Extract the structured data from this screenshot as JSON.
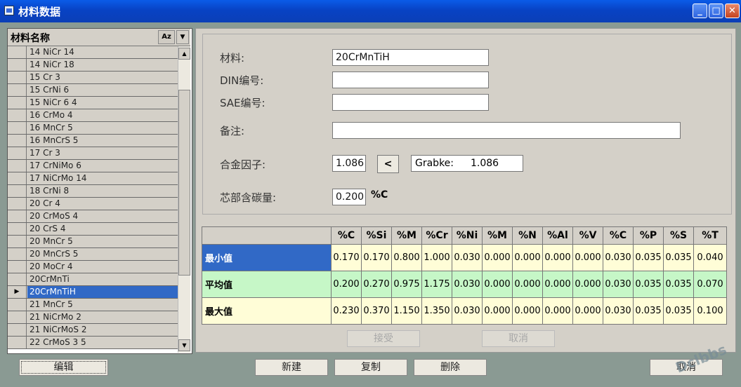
{
  "window": {
    "title": "材料数据"
  },
  "list": {
    "header": "材料名称",
    "sort_label": "Az",
    "items": [
      {
        "name": "14 NiCr 14"
      },
      {
        "name": "14 NiCr 18"
      },
      {
        "name": "15 Cr 3"
      },
      {
        "name": "15 CrNi 6"
      },
      {
        "name": "15 NiCr 6 4"
      },
      {
        "name": "16 CrMo 4"
      },
      {
        "name": "16 MnCr 5"
      },
      {
        "name": "16 MnCrS 5"
      },
      {
        "name": "17 Cr 3"
      },
      {
        "name": "17 CrNiMo 6"
      },
      {
        "name": "17 NiCrMo 14"
      },
      {
        "name": "18 CrNi 8"
      },
      {
        "name": "20 Cr 4"
      },
      {
        "name": "20 CrMoS 4"
      },
      {
        "name": "20 CrS 4"
      },
      {
        "name": "20 MnCr 5"
      },
      {
        "name": "20 MnCrS 5"
      },
      {
        "name": "20 MoCr 4"
      },
      {
        "name": "20CrMnTi"
      },
      {
        "name": "20CrMnTiH"
      },
      {
        "name": "21 MnCr 5"
      },
      {
        "name": "21 NiCrMo 2"
      },
      {
        "name": "21 NiCrMoS 2"
      },
      {
        "name": "22 CrMoS 3 5"
      }
    ],
    "selected_index": 19,
    "selector_marker": "▶"
  },
  "form": {
    "material_label": "材料:",
    "material_value": "20CrMnTiH",
    "din_label": "DIN编号:",
    "din_value": "",
    "sae_label": "SAE编号:",
    "sae_value": "",
    "remark_label": "备注:",
    "remark_value": "",
    "alloy_label": "合金因子:",
    "alloy_value": "1.086",
    "less_button": "<",
    "grabke_label": "Grabke:",
    "grabke_value": "1.086",
    "core_carbon_label": "芯部含碳量:",
    "core_carbon_value": "0.200",
    "core_carbon_unit": "%C"
  },
  "table": {
    "columns": [
      "%C",
      "%Si",
      "%M",
      "%Cr",
      "%Ni",
      "%M",
      "%N",
      "%Al",
      "%V",
      "%C",
      "%P",
      "%S",
      "%T"
    ],
    "rows": [
      {
        "label": "最小值",
        "values": [
          "0.170",
          "0.170",
          "0.800",
          "1.000",
          "0.030",
          "0.000",
          "0.000",
          "0.000",
          "0.000",
          "0.030",
          "0.035",
          "0.035",
          "0.040"
        ]
      },
      {
        "label": "平均值",
        "values": [
          "0.200",
          "0.270",
          "0.975",
          "1.175",
          "0.030",
          "0.000",
          "0.000",
          "0.000",
          "0.000",
          "0.030",
          "0.035",
          "0.035",
          "0.070"
        ]
      },
      {
        "label": "最大值",
        "values": [
          "0.230",
          "0.370",
          "1.150",
          "1.350",
          "0.030",
          "0.000",
          "0.000",
          "0.000",
          "0.000",
          "0.030",
          "0.035",
          "0.035",
          "0.100"
        ]
      }
    ]
  },
  "buttons": {
    "accept": "接受",
    "cancel_inner": "取消",
    "edit": "编辑",
    "new": "新建",
    "copy": "复制",
    "delete": "删除",
    "cancel": "取消"
  },
  "watermark": "Dclbbs",
  "colors": {
    "selection": "#3169c6",
    "avg_row": "#c6f7c7",
    "minmax_row": "#fffdd7",
    "titlebar": "#0842c4"
  }
}
